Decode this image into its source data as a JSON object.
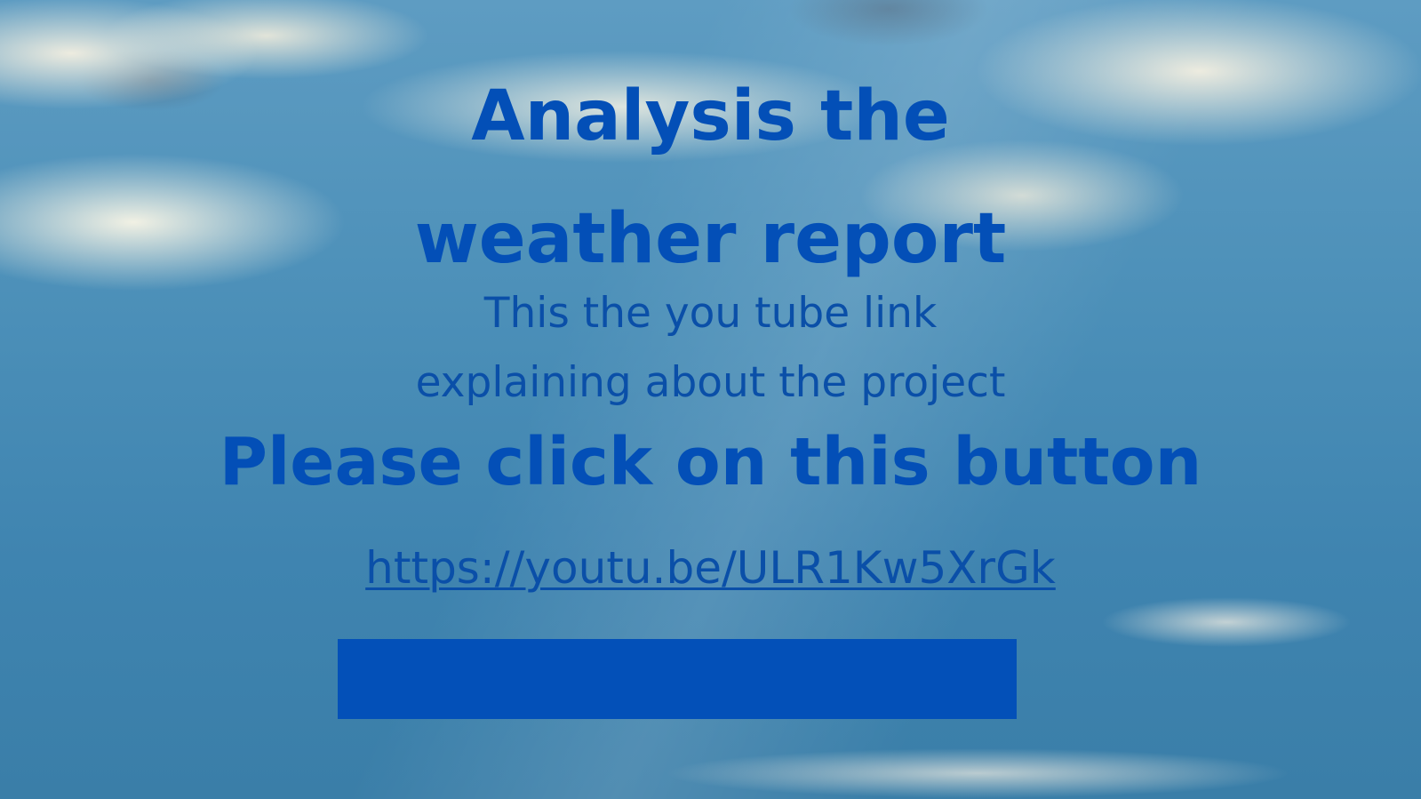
{
  "title_lines": {
    "line1": "Analysis the",
    "line2": "weather report"
  },
  "subtitle_lines": {
    "line1": "This the you tube link",
    "line2": "explaining about the project"
  },
  "cta_text": "Please click on this button",
  "link": {
    "text": "https://youtu.be/ULR1Kw5XrGk"
  },
  "button": {
    "label": ""
  },
  "colors": {
    "text_blue": "#034fb7",
    "button_blue": "#0350b8",
    "sky_blue": "#4b8fb8"
  }
}
